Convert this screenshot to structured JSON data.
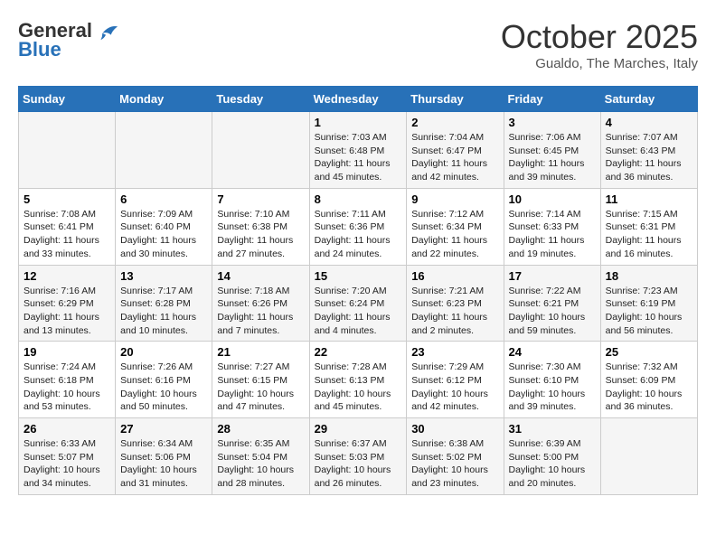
{
  "header": {
    "logo_line1": "General",
    "logo_line2": "Blue",
    "month": "October 2025",
    "location": "Gualdo, The Marches, Italy"
  },
  "days_of_week": [
    "Sunday",
    "Monday",
    "Tuesday",
    "Wednesday",
    "Thursday",
    "Friday",
    "Saturday"
  ],
  "weeks": [
    [
      {
        "day": "",
        "info": ""
      },
      {
        "day": "",
        "info": ""
      },
      {
        "day": "",
        "info": ""
      },
      {
        "day": "1",
        "info": "Sunrise: 7:03 AM\nSunset: 6:48 PM\nDaylight: 11 hours and 45 minutes."
      },
      {
        "day": "2",
        "info": "Sunrise: 7:04 AM\nSunset: 6:47 PM\nDaylight: 11 hours and 42 minutes."
      },
      {
        "day": "3",
        "info": "Sunrise: 7:06 AM\nSunset: 6:45 PM\nDaylight: 11 hours and 39 minutes."
      },
      {
        "day": "4",
        "info": "Sunrise: 7:07 AM\nSunset: 6:43 PM\nDaylight: 11 hours and 36 minutes."
      }
    ],
    [
      {
        "day": "5",
        "info": "Sunrise: 7:08 AM\nSunset: 6:41 PM\nDaylight: 11 hours and 33 minutes."
      },
      {
        "day": "6",
        "info": "Sunrise: 7:09 AM\nSunset: 6:40 PM\nDaylight: 11 hours and 30 minutes."
      },
      {
        "day": "7",
        "info": "Sunrise: 7:10 AM\nSunset: 6:38 PM\nDaylight: 11 hours and 27 minutes."
      },
      {
        "day": "8",
        "info": "Sunrise: 7:11 AM\nSunset: 6:36 PM\nDaylight: 11 hours and 24 minutes."
      },
      {
        "day": "9",
        "info": "Sunrise: 7:12 AM\nSunset: 6:34 PM\nDaylight: 11 hours and 22 minutes."
      },
      {
        "day": "10",
        "info": "Sunrise: 7:14 AM\nSunset: 6:33 PM\nDaylight: 11 hours and 19 minutes."
      },
      {
        "day": "11",
        "info": "Sunrise: 7:15 AM\nSunset: 6:31 PM\nDaylight: 11 hours and 16 minutes."
      }
    ],
    [
      {
        "day": "12",
        "info": "Sunrise: 7:16 AM\nSunset: 6:29 PM\nDaylight: 11 hours and 13 minutes."
      },
      {
        "day": "13",
        "info": "Sunrise: 7:17 AM\nSunset: 6:28 PM\nDaylight: 11 hours and 10 minutes."
      },
      {
        "day": "14",
        "info": "Sunrise: 7:18 AM\nSunset: 6:26 PM\nDaylight: 11 hours and 7 minutes."
      },
      {
        "day": "15",
        "info": "Sunrise: 7:20 AM\nSunset: 6:24 PM\nDaylight: 11 hours and 4 minutes."
      },
      {
        "day": "16",
        "info": "Sunrise: 7:21 AM\nSunset: 6:23 PM\nDaylight: 11 hours and 2 minutes."
      },
      {
        "day": "17",
        "info": "Sunrise: 7:22 AM\nSunset: 6:21 PM\nDaylight: 10 hours and 59 minutes."
      },
      {
        "day": "18",
        "info": "Sunrise: 7:23 AM\nSunset: 6:19 PM\nDaylight: 10 hours and 56 minutes."
      }
    ],
    [
      {
        "day": "19",
        "info": "Sunrise: 7:24 AM\nSunset: 6:18 PM\nDaylight: 10 hours and 53 minutes."
      },
      {
        "day": "20",
        "info": "Sunrise: 7:26 AM\nSunset: 6:16 PM\nDaylight: 10 hours and 50 minutes."
      },
      {
        "day": "21",
        "info": "Sunrise: 7:27 AM\nSunset: 6:15 PM\nDaylight: 10 hours and 47 minutes."
      },
      {
        "day": "22",
        "info": "Sunrise: 7:28 AM\nSunset: 6:13 PM\nDaylight: 10 hours and 45 minutes."
      },
      {
        "day": "23",
        "info": "Sunrise: 7:29 AM\nSunset: 6:12 PM\nDaylight: 10 hours and 42 minutes."
      },
      {
        "day": "24",
        "info": "Sunrise: 7:30 AM\nSunset: 6:10 PM\nDaylight: 10 hours and 39 minutes."
      },
      {
        "day": "25",
        "info": "Sunrise: 7:32 AM\nSunset: 6:09 PM\nDaylight: 10 hours and 36 minutes."
      }
    ],
    [
      {
        "day": "26",
        "info": "Sunrise: 6:33 AM\nSunset: 5:07 PM\nDaylight: 10 hours and 34 minutes."
      },
      {
        "day": "27",
        "info": "Sunrise: 6:34 AM\nSunset: 5:06 PM\nDaylight: 10 hours and 31 minutes."
      },
      {
        "day": "28",
        "info": "Sunrise: 6:35 AM\nSunset: 5:04 PM\nDaylight: 10 hours and 28 minutes."
      },
      {
        "day": "29",
        "info": "Sunrise: 6:37 AM\nSunset: 5:03 PM\nDaylight: 10 hours and 26 minutes."
      },
      {
        "day": "30",
        "info": "Sunrise: 6:38 AM\nSunset: 5:02 PM\nDaylight: 10 hours and 23 minutes."
      },
      {
        "day": "31",
        "info": "Sunrise: 6:39 AM\nSunset: 5:00 PM\nDaylight: 10 hours and 20 minutes."
      },
      {
        "day": "",
        "info": ""
      }
    ]
  ]
}
